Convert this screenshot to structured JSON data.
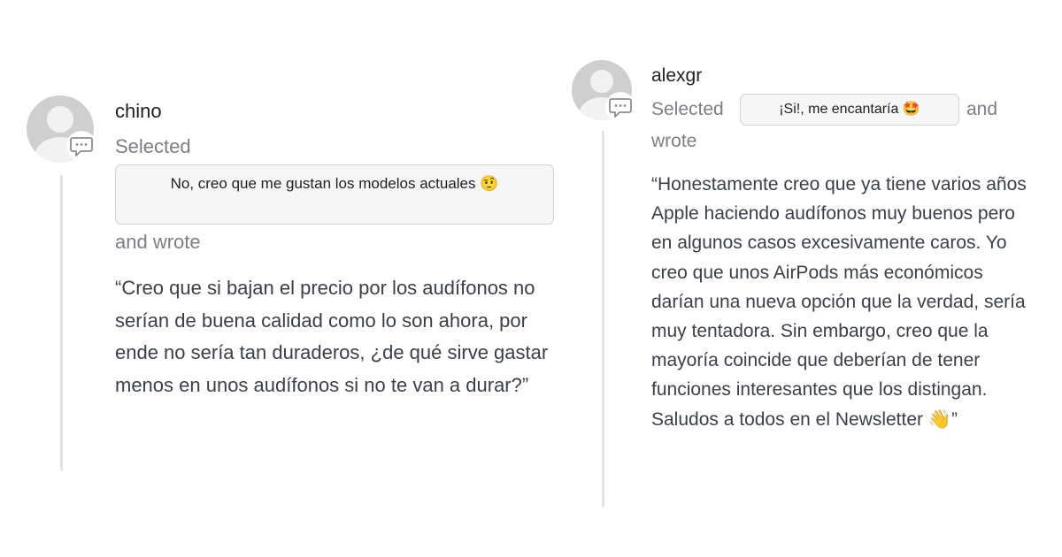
{
  "comments": [
    {
      "username": "chino",
      "selected_label": "Selected",
      "choice": "No, creo que me gustan los modelos actuales 🤨",
      "wrote_label": "and wrote",
      "quote": "“Creo que si bajan el precio por los audífonos no serían de buena calidad como lo son ahora, por ende no sería tan duraderos, ¿de qué sirve gastar menos en unos audífonos si no te van a durar?”"
    },
    {
      "username": "alexgr",
      "selected_label": "Selected",
      "choice": "¡Si!, me encantaría 🤩",
      "and_label": "and",
      "wrote_label": "wrote",
      "quote": "“Honestamente creo que ya tiene varios años Apple haciendo audífonos muy buenos pero en algunos casos excesivamente caros. Yo creo que unos AirPods más económicos darían una nueva opción que la verdad, sería muy tentadora. Sin embargo, creo que la mayoría coincide que deberían de tener funciones interesantes que los distingan. Saludos a todos en el Newsletter 👋”"
    }
  ],
  "icons": {
    "avatar": "default-user-avatar",
    "comment": "comment-bubble-icon"
  },
  "colors": {
    "meta_text": "#7c7f84",
    "quote_text": "#3b4048",
    "pill_border": "#cfd2d6",
    "pill_bg": "#f5f6f7",
    "rail": "#e4e4e6"
  }
}
